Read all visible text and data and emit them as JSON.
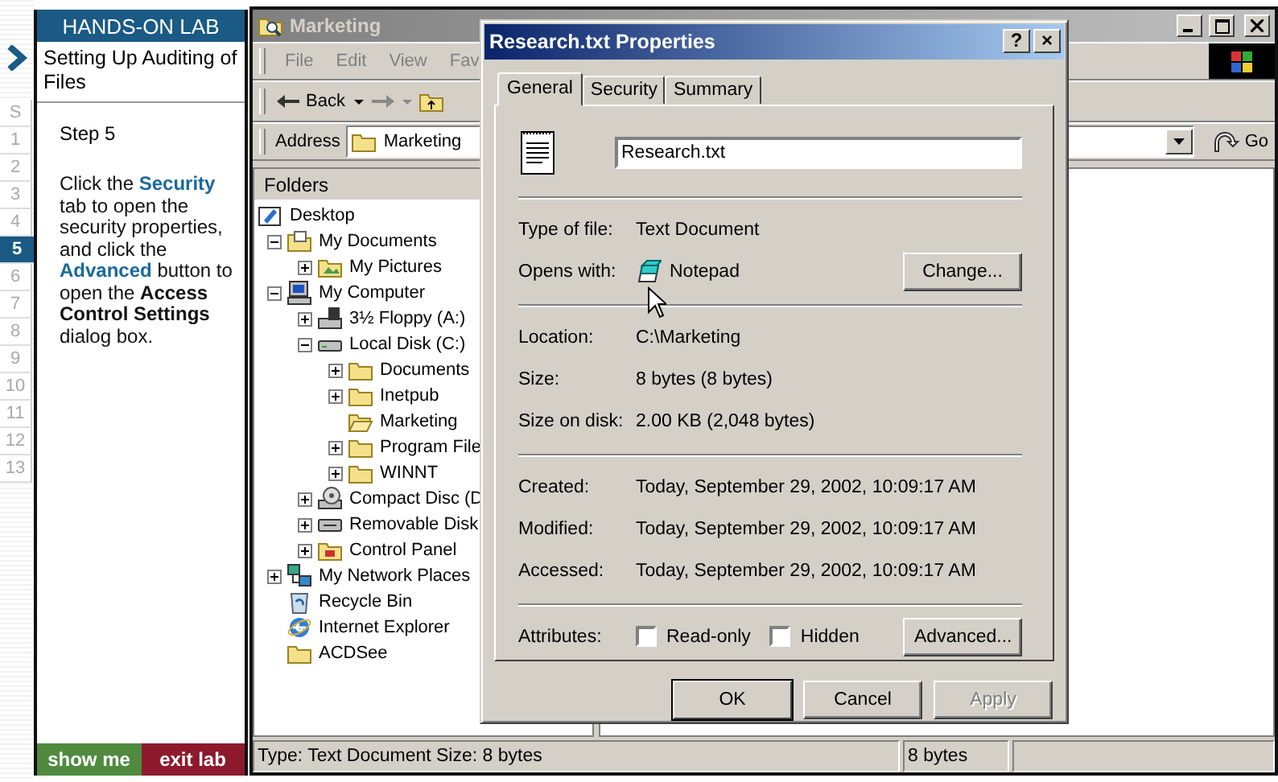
{
  "steps": [
    {
      "label": "S",
      "selected": false
    },
    {
      "label": "1",
      "selected": false
    },
    {
      "label": "2",
      "selected": false
    },
    {
      "label": "3",
      "selected": false
    },
    {
      "label": "4",
      "selected": false
    },
    {
      "label": "5",
      "selected": true
    },
    {
      "label": "6",
      "selected": false
    },
    {
      "label": "7",
      "selected": false
    },
    {
      "label": "8",
      "selected": false
    },
    {
      "label": "9",
      "selected": false
    },
    {
      "label": "10",
      "selected": false
    },
    {
      "label": "11",
      "selected": false
    },
    {
      "label": "12",
      "selected": false
    },
    {
      "label": "13",
      "selected": false
    }
  ],
  "lab": {
    "header": "HANDS-ON LAB",
    "title": "Setting Up Auditing of Files",
    "step": "Step 5",
    "instructions": [
      {
        "text": "Click the ",
        "kind": "plain"
      },
      {
        "text": "Security",
        "kind": "term"
      },
      {
        "text": " tab to open the security properties, and click the ",
        "kind": "plain"
      },
      {
        "text": "Advanced",
        "kind": "term"
      },
      {
        "text": " button to open the ",
        "kind": "plain"
      },
      {
        "text": "Access Control Settings",
        "kind": "bold"
      },
      {
        "text": " dialog box.",
        "kind": "plain"
      }
    ],
    "buttons": [
      {
        "label": "show me",
        "kind": "show"
      },
      {
        "label": "exit lab",
        "kind": "exit"
      }
    ]
  },
  "explorer": {
    "title": "Marketing",
    "menu": [
      "File",
      "Edit",
      "View",
      "Fav"
    ],
    "back": "Back",
    "address": {
      "label": "Address",
      "value": "Marketing",
      "go": "Go"
    },
    "folders_title": "Folders",
    "tree": [
      {
        "label": "Desktop",
        "kind": "desktop",
        "children": [
          {
            "label": "My Documents",
            "kind": "documents",
            "expanded": true,
            "children": [
              {
                "label": "My Pictures",
                "kind": "pictures",
                "expanded": false
              }
            ]
          },
          {
            "label": "My Computer",
            "kind": "computer",
            "expanded": true,
            "children": [
              {
                "label": "3½ Floppy (A:)",
                "kind": "floppy",
                "expanded": false
              },
              {
                "label": "Local Disk (C:)",
                "kind": "drive",
                "expanded": true,
                "children": [
                  {
                    "label": "Documents",
                    "kind": "folder",
                    "expanded": false
                  },
                  {
                    "label": "Inetpub",
                    "kind": "folder",
                    "expanded": false
                  },
                  {
                    "label": "Marketing",
                    "kind": "open-folder"
                  },
                  {
                    "label": "Program File",
                    "kind": "folder",
                    "expanded": false
                  },
                  {
                    "label": "WINNT",
                    "kind": "folder",
                    "expanded": false
                  }
                ]
              },
              {
                "label": "Compact Disc (D",
                "kind": "cdrom",
                "expanded": false
              },
              {
                "label": "Removable Disk",
                "kind": "removable",
                "expanded": false
              },
              {
                "label": "Control Panel",
                "kind": "control",
                "expanded": false
              }
            ]
          },
          {
            "label": "My Network Places",
            "kind": "network",
            "expanded": false
          },
          {
            "label": "Recycle Bin",
            "kind": "recycle"
          },
          {
            "label": "Internet Explorer",
            "kind": "ie"
          },
          {
            "label": "ACDSee",
            "kind": "folder"
          }
        ]
      }
    ],
    "status_bar": [
      "Type: Text Document Size: 8 bytes",
      "8 bytes"
    ]
  },
  "dialog": {
    "title": "Research.txt Properties",
    "help": "?",
    "close": "×",
    "tabs": [
      {
        "label": "General",
        "selected": true
      },
      {
        "label": "Security",
        "selected": false
      },
      {
        "label": "Summary",
        "selected": false
      }
    ],
    "file_name": "Research.txt",
    "groups": [
      [
        {
          "label": "Type of file:",
          "value": "Text Document",
          "kind": "text"
        },
        {
          "label": "Opens with:",
          "value": "Notepad",
          "kind": "app",
          "button": "Change..."
        }
      ],
      [
        {
          "label": "Location:",
          "value": "C:\\Marketing",
          "kind": "text"
        },
        {
          "label": "Size:",
          "value": "8 bytes (8 bytes)",
          "kind": "text"
        },
        {
          "label": "Size on disk:",
          "value": "2.00 KB (2,048 bytes)",
          "kind": "text"
        }
      ],
      [
        {
          "label": "Created:",
          "value": "Today, September 29, 2002, 10:09:17 AM",
          "kind": "text"
        },
        {
          "label": "Modified:",
          "value": "Today, September 29, 2002, 10:09:17 AM",
          "kind": "text"
        },
        {
          "label": "Accessed:",
          "value": "Today, September 29, 2002, 10:09:17 AM",
          "kind": "text"
        }
      ]
    ],
    "attributes": {
      "label": "Attributes:",
      "items": [
        {
          "label": "Read-only",
          "checked": false
        },
        {
          "label": "Hidden",
          "checked": false
        }
      ],
      "button": "Advanced..."
    },
    "buttons": [
      {
        "label": "OK",
        "disabled": false,
        "default": true
      },
      {
        "label": "Cancel",
        "disabled": false,
        "default": false
      },
      {
        "label": "Apply",
        "disabled": true,
        "default": false
      }
    ]
  }
}
